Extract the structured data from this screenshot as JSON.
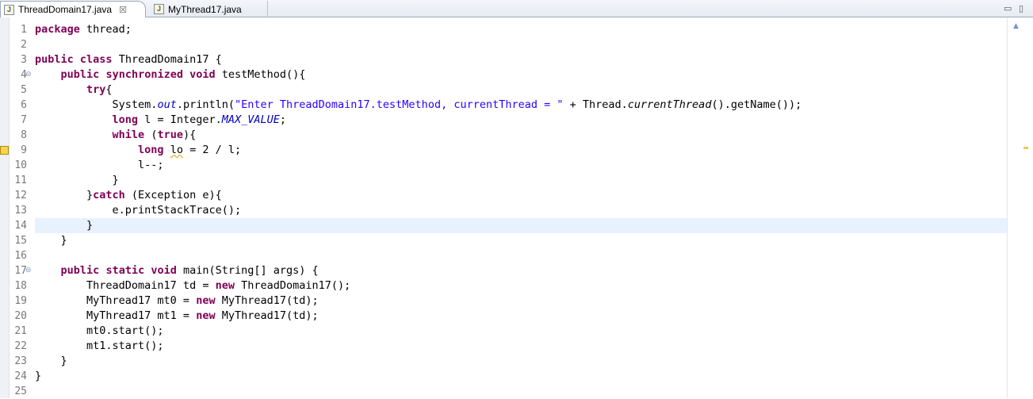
{
  "tabs": [
    {
      "label": "ThreadDomain17.java",
      "active": true,
      "icon": "java-file-icon",
      "close": "☒"
    },
    {
      "label": "MyThread17.java",
      "active": false,
      "icon": "java-file-icon"
    }
  ],
  "window_controls": {
    "minimize": "▭",
    "maximize": "▯"
  },
  "editor": {
    "current_line": 14,
    "warning_line": 9,
    "fold_lines": [
      4,
      17
    ],
    "line_numbers": [
      "1",
      "2",
      "3",
      "4",
      "5",
      "6",
      "7",
      "8",
      "9",
      "10",
      "11",
      "12",
      "13",
      "14",
      "15",
      "16",
      "17",
      "18",
      "19",
      "20",
      "21",
      "22",
      "23",
      "24",
      "25"
    ],
    "lines": [
      [
        {
          "t": "package",
          "c": "kw"
        },
        {
          "t": " thread;"
        }
      ],
      [],
      [
        {
          "t": "public",
          "c": "kw"
        },
        {
          "t": " "
        },
        {
          "t": "class",
          "c": "kw"
        },
        {
          "t": " ThreadDomain17 {"
        }
      ],
      [
        {
          "t": "    "
        },
        {
          "t": "public",
          "c": "kw"
        },
        {
          "t": " "
        },
        {
          "t": "synchronized",
          "c": "kw"
        },
        {
          "t": " "
        },
        {
          "t": "void",
          "c": "kw"
        },
        {
          "t": " testMethod(){"
        }
      ],
      [
        {
          "t": "        "
        },
        {
          "t": "try",
          "c": "kw"
        },
        {
          "t": "{"
        }
      ],
      [
        {
          "t": "            System."
        },
        {
          "t": "out",
          "c": "cst"
        },
        {
          "t": ".println("
        },
        {
          "t": "\"Enter ThreadDomain17.testMethod, currentThread = \"",
          "c": "str"
        },
        {
          "t": " + Thread."
        },
        {
          "t": "currentThread",
          "c": "it"
        },
        {
          "t": "().getName());"
        }
      ],
      [
        {
          "t": "            "
        },
        {
          "t": "long",
          "c": "kw"
        },
        {
          "t": " l = Integer."
        },
        {
          "t": "MAX_VALUE",
          "c": "cst"
        },
        {
          "t": ";"
        }
      ],
      [
        {
          "t": "            "
        },
        {
          "t": "while",
          "c": "kw"
        },
        {
          "t": " ("
        },
        {
          "t": "true",
          "c": "kw"
        },
        {
          "t": "){"
        }
      ],
      [
        {
          "t": "                "
        },
        {
          "t": "long",
          "c": "kw"
        },
        {
          "t": " "
        },
        {
          "t": "lo",
          "c": "warnword"
        },
        {
          "t": " = 2 / l;"
        }
      ],
      [
        {
          "t": "                l--;"
        }
      ],
      [
        {
          "t": "            }"
        }
      ],
      [
        {
          "t": "        }"
        },
        {
          "t": "catch",
          "c": "kw"
        },
        {
          "t": " (Exception e){"
        }
      ],
      [
        {
          "t": "            e.printStackTrace();"
        }
      ],
      [
        {
          "t": "        }"
        }
      ],
      [
        {
          "t": "    }"
        }
      ],
      [],
      [
        {
          "t": "    "
        },
        {
          "t": "public",
          "c": "kw"
        },
        {
          "t": " "
        },
        {
          "t": "static",
          "c": "kw"
        },
        {
          "t": " "
        },
        {
          "t": "void",
          "c": "kw"
        },
        {
          "t": " main(String[] args) {"
        }
      ],
      [
        {
          "t": "        ThreadDomain17 td = "
        },
        {
          "t": "new",
          "c": "kw"
        },
        {
          "t": " ThreadDomain17();"
        }
      ],
      [
        {
          "t": "        MyThread17 mt0 = "
        },
        {
          "t": "new",
          "c": "kw"
        },
        {
          "t": " MyThread17(td);"
        }
      ],
      [
        {
          "t": "        MyThread17 mt1 = "
        },
        {
          "t": "new",
          "c": "kw"
        },
        {
          "t": " MyThread17(td);"
        }
      ],
      [
        {
          "t": "        mt0.start();"
        }
      ],
      [
        {
          "t": "        mt1.start();"
        }
      ],
      [
        {
          "t": "    }"
        }
      ],
      [
        {
          "t": "}"
        }
      ],
      []
    ],
    "fold_glyph": "⊖",
    "overview_arrow": "▲"
  },
  "colors": {
    "keyword": "#7f0055",
    "string": "#2a00ff",
    "constant": "#0000c0",
    "current_line": "#e8f2fe"
  }
}
